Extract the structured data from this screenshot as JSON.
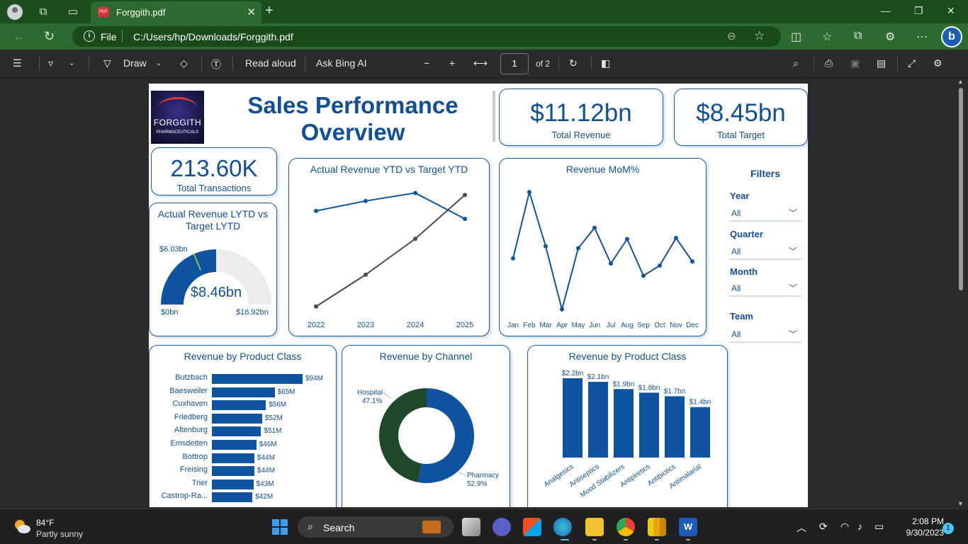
{
  "browser": {
    "tab_title": "Forggith.pdf",
    "file_label": "File",
    "url": "C:/Users/hp/Downloads/Forggith.pdf"
  },
  "pdf_toolbar": {
    "draw_label": "Draw",
    "read_aloud_label": "Read aloud",
    "ask_bing_label": "Ask Bing AI",
    "page_number": "1",
    "page_total": "of 2"
  },
  "dashboard": {
    "logo_line1": "FORGGITH",
    "logo_line2": "PHARMACEUTICALS",
    "title_line1": "Sales Performance",
    "title_line2": "Overview",
    "total_revenue": {
      "value": "$11.12bn",
      "label": "Total Revenue"
    },
    "total_target": {
      "value": "$8.45bn",
      "label": "Total Target"
    },
    "total_transactions": {
      "value": "213.60K",
      "label": "Total Transactions"
    },
    "gauge": {
      "title_line1": "Actual Revenue LYTD vs",
      "title_line2": "Target LYTD",
      "target_label": "$6.03bn",
      "value_label": "$8.46bn",
      "min_label": "$0bn",
      "max_label": "$16.92bn"
    },
    "filters": {
      "title": "Filters",
      "year_label": "Year",
      "year_value": "All",
      "quarter_label": "Quarter",
      "quarter_value": "All",
      "month_label": "Month",
      "month_value": "All",
      "team_label": "Team",
      "team_value": "All"
    }
  },
  "chart_data": [
    {
      "type": "line",
      "title": "Actual Revenue YTD vs Target YTD",
      "categories": [
        "2022",
        "2023",
        "2024",
        "2025"
      ],
      "series": [
        {
          "values": [
            3.1,
            3.35,
            3.55,
            2.9
          ],
          "color": "#0e54a1"
        },
        {
          "values": [
            0.7,
            1.5,
            2.4,
            3.5
          ],
          "color": "#4a4a4a"
        }
      ]
    },
    {
      "type": "line",
      "title": "Revenue MoM%",
      "categories": [
        "Jan",
        "Feb",
        "Mar",
        "Apr",
        "May",
        "Jun",
        "Jul",
        "Aug",
        "Sep",
        "Oct",
        "Nov",
        "Dec"
      ],
      "series": [
        {
          "values": [
            -5,
            60,
            7,
            -55,
            5,
            25,
            -10,
            14,
            -22,
            -12,
            15,
            -8
          ],
          "color": "#0e54a1"
        }
      ]
    },
    {
      "type": "bar",
      "orientation": "horizontal",
      "title": "Revenue by Product Class",
      "categories": [
        "Butzbach",
        "Baesweiler",
        "Cuxhaven",
        "Friedberg",
        "Altenburg",
        "Emsdetten",
        "Bottrop",
        "Freising",
        "Trier",
        "Castrop-Ra..."
      ],
      "values": [
        94,
        65,
        56,
        52,
        51,
        46,
        44,
        44,
        43,
        42
      ],
      "value_labels": [
        "$94M",
        "$65M",
        "$56M",
        "$52M",
        "$51M",
        "$46M",
        "$44M",
        "$44M",
        "$43M",
        "$42M"
      ]
    },
    {
      "type": "pie",
      "title": "Revenue by Channel",
      "categories": [
        "Pharmacy",
        "Hospital"
      ],
      "values": [
        52.9,
        47.1
      ],
      "value_labels": [
        "52.9%",
        "47.1%"
      ],
      "colors": [
        "#0e54a1",
        "#1f4a2a"
      ]
    },
    {
      "type": "bar",
      "title": "Revenue by Product Class",
      "categories": [
        "Analgesics",
        "Antiseptics",
        "Mood Stabilizers",
        "Antipiretics",
        "Antibiotics",
        "Antimalarial"
      ],
      "values": [
        2.2,
        2.1,
        1.9,
        1.8,
        1.7,
        1.4
      ],
      "value_labels": [
        "$2.2bn",
        "$2.1bn",
        "$1.9bn",
        "$1.8bn",
        "$1.7bn",
        "$1.4bn"
      ]
    }
  ],
  "taskbar": {
    "temperature": "84°F",
    "weather": "Partly sunny",
    "search_label": "Search",
    "time": "2:08 PM",
    "date": "9/30/2023",
    "notification_count": "1"
  }
}
